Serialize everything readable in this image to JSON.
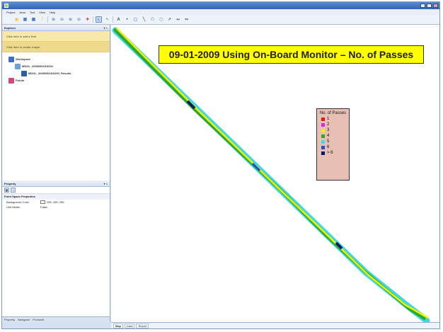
{
  "window": {
    "title": "",
    "minimize_icon": "minimize-icon",
    "maximize_icon": "maximize-icon",
    "close_icon": "close-icon"
  },
  "menu": [
    "Project",
    "Area",
    "Tool",
    "View",
    "Help"
  ],
  "toolbar": {
    "icons": [
      "new-icon",
      "open-icon",
      "save-icon",
      "save-as-icon",
      "help-icon",
      "zoom-in-icon",
      "zoom-out-icon",
      "zoom-in-icon",
      "zoom-out-icon",
      "pan-icon",
      "select-icon",
      "pointer-icon",
      "text-icon",
      "point-icon",
      "rectangle-icon",
      "line-icon",
      "polygon-icon",
      "ellipse-icon",
      "arrow-icon",
      "measure-icon",
      "scale-icon"
    ],
    "glyphs": [
      "□",
      "▣",
      "■",
      "■",
      "?",
      "⊕",
      "⊖",
      "⊕",
      "⊖",
      "✚",
      "↖",
      "↖",
      "A",
      "•",
      "□",
      "╲",
      "⬠",
      "○",
      "↗",
      "↔",
      "⇔"
    ],
    "selected_index": 10
  },
  "explorer": {
    "title": "Explorer",
    "controls": "▾ ×",
    "tasks": [
      "Click here to add a field",
      "Click here to create a layer"
    ],
    "tree": [
      {
        "label": "Workspace",
        "icon": "workspace-icon",
        "indent": 1
      },
      {
        "label": "MDOL_20090901SS200",
        "icon": "dataset-icon",
        "indent": 2
      },
      {
        "label": "MDOL_20090901SS200_Results",
        "icon": "layer-icon",
        "indent": 3
      },
      {
        "label": "Points",
        "icon": "points-icon",
        "indent": 1
      }
    ]
  },
  "property": {
    "title": "Property",
    "controls": "▾ ×",
    "tab_icons": [
      "categorized-icon",
      "alphabetical-icon"
    ],
    "section": "Point Space Properties",
    "rows": [
      {
        "key": "Background Color",
        "value": "255, 255, 255",
        "swatch": "#ffffff"
      },
      {
        "key": "Unit Metric",
        "value": "False"
      }
    ]
  },
  "left_bottom_tabs": [
    "Property",
    "Navigator",
    "Products"
  ],
  "map": {
    "title": "09-01-2009 Using On-Board Monitor – No. of Passes",
    "legend_title": "No. of Passes",
    "legend": [
      {
        "label": "1",
        "color": "#e01a1a"
      },
      {
        "label": "2",
        "color": "#d62fd6"
      },
      {
        "label": "3",
        "color": "#f3f000"
      },
      {
        "label": "4",
        "color": "#2ea82e"
      },
      {
        "label": "5",
        "color": "#3fd9e3"
      },
      {
        "label": "6",
        "color": "#2b4cc8"
      },
      {
        "label": "> 6",
        "color": "#0a1a66"
      }
    ]
  },
  "view_tabs": [
    "Map",
    "Data",
    "Report"
  ]
}
